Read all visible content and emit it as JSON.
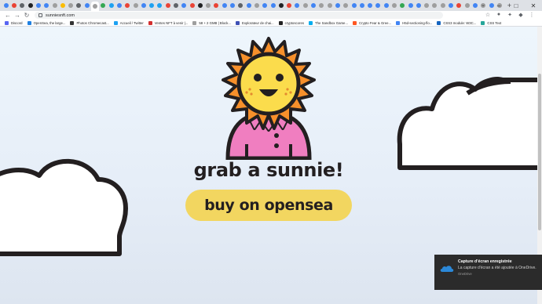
{
  "browser": {
    "url": "sunniesnft.com",
    "new_tab_icon": "+",
    "tab_search_icon": "⌄",
    "window_controls": [
      "–",
      "□",
      "✕"
    ],
    "nav_icons": [
      "←",
      "→",
      "↻"
    ],
    "tab_favicon_colors": [
      "#4285f4",
      "#ea4335",
      "#5f6368",
      "#202124",
      "#4285f4",
      "#4285f4",
      "#9e9e9e",
      "#fbbc04",
      "#9e9e9e",
      "#5f6368",
      "#4285f4",
      "#9e9e9e",
      "#34a853",
      "#1da1f2",
      "#4285f4",
      "#ea4335",
      "#9e9e9e",
      "#4285f4",
      "#1da1f2",
      "#1da1f2",
      "#ea4335",
      "#5f6368",
      "#4285f4",
      "#ea4335",
      "#202124",
      "#9e9e9e",
      "#ea4335",
      "#4285f4",
      "#4285f4",
      "#5f6368",
      "#4285f4",
      "#9e9e9e",
      "#4285f4",
      "#4285f4",
      "#202124",
      "#ea4335",
      "#4285f4",
      "#9e9e9e",
      "#4285f4",
      "#9e9e9e",
      "#9e9e9e",
      "#4285f4",
      "#9e9e9e",
      "#4285f4",
      "#4285f4",
      "#4285f4",
      "#4285f4",
      "#4285f4",
      "#9e9e9e",
      "#34a853",
      "#4285f4",
      "#4285f4",
      "#9e9e9e",
      "#9e9e9e",
      "#9e9e9e",
      "#4285f4",
      "#ea4335",
      "#9e9e9e",
      "#4285f4",
      "#9e9e9e",
      "#4285f4",
      "#9e9e9e"
    ],
    "active_tab_index": 11,
    "omnibox_icons": [
      "☆",
      "●",
      "✦",
      "◆",
      "⋮"
    ]
  },
  "bookmarks": [
    {
      "label": "Discord",
      "color": "#5865f2"
    },
    {
      "label": "OpenSea, the large...",
      "color": "#2081e2"
    },
    {
      "label": "Photos Chromecast...",
      "color": "#333333"
    },
    {
      "label": "Accueil / Twitter",
      "color": "#1da1f2"
    },
    {
      "label": "Ventes NFT à venir |...",
      "color": "#d32f2f"
    },
    {
      "label": "58 + 2 GMB | Block...",
      "color": "#9e9e9e"
    },
    {
      "label": "Explorateur de chai...",
      "color": "#3f51b5"
    },
    {
      "label": "cryptoscores",
      "color": "#222222"
    },
    {
      "label": "The Sandbox Game...",
      "color": "#00adef"
    },
    {
      "label": "Crypto Fear & Gree...",
      "color": "#ff5722"
    },
    {
      "label": "H5d-sectioning-flo...",
      "color": "#4285f4"
    },
    {
      "label": "CSS3 module: W3C...",
      "color": "#1565c0"
    },
    {
      "label": "CSS Text",
      "color": "#26a69a"
    }
  ],
  "page": {
    "headline": "grab a sunnie!",
    "cta": "buy on opensea"
  },
  "toast": {
    "title": "Capture d'écran enregistrée",
    "body": "La capture d'écran a été ajoutée à OneDrive.",
    "app": "OneDrive"
  }
}
